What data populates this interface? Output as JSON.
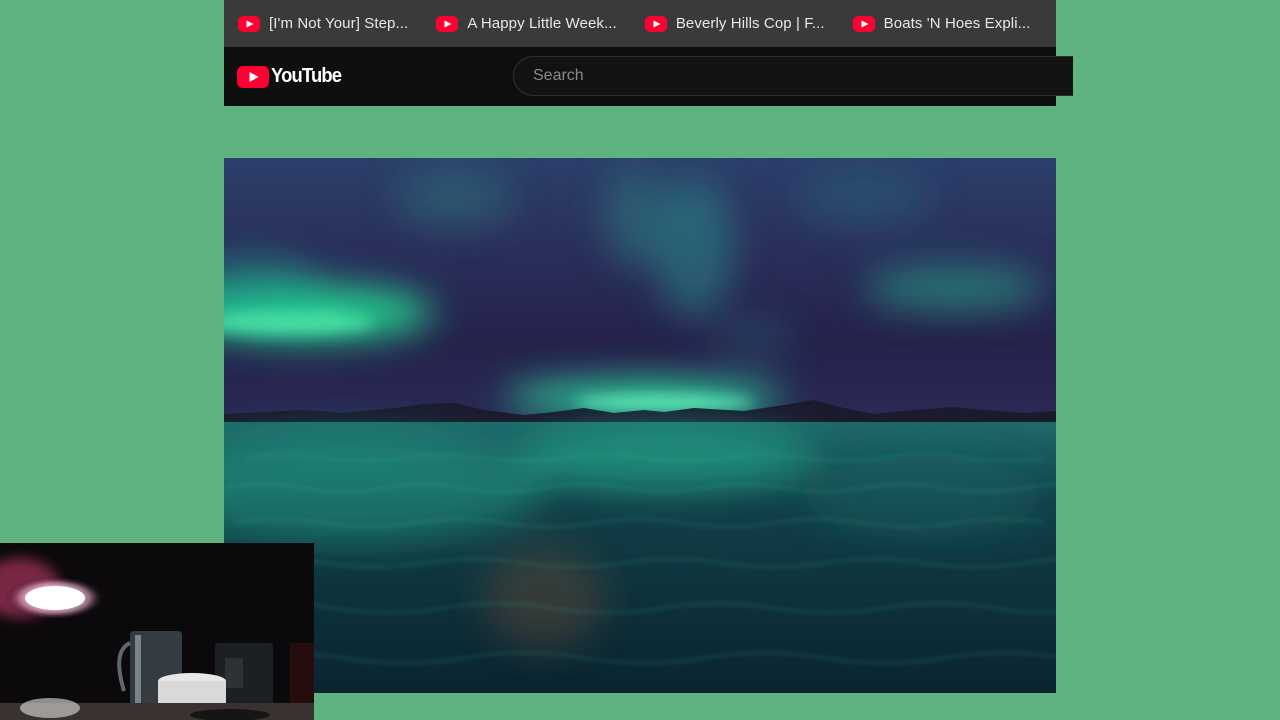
{
  "bookmarks": [
    {
      "label": "[I'm Not Your] Step...",
      "icon": "youtube-favicon"
    },
    {
      "label": "A Happy Little Week...",
      "icon": "youtube-favicon"
    },
    {
      "label": "Beverly Hills Cop | F...",
      "icon": "youtube-favicon"
    },
    {
      "label": "Boats 'N Hoes Expli...",
      "icon": "youtube-favicon"
    }
  ],
  "header": {
    "logo_text": "YouTube",
    "search_placeholder": "Search"
  },
  "colors": {
    "background": "#5fb380",
    "youtube_red": "#ff0000",
    "header_bg": "#0f0f0f",
    "bookmark_bar_bg": "#3a3a3a"
  },
  "video": {
    "description_icon": "aurora-video-frame"
  },
  "webcam": {
    "icon": "webcam-overlay"
  }
}
